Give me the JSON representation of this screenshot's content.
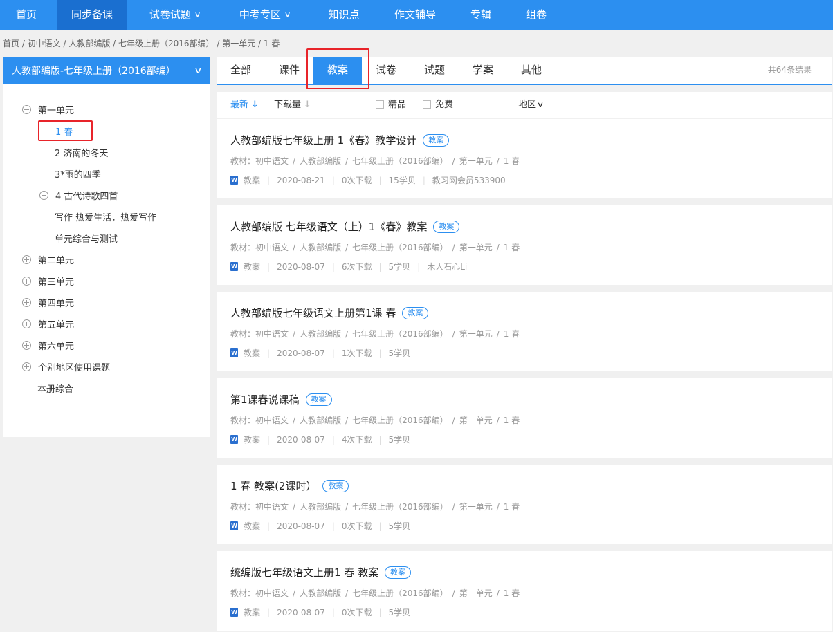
{
  "nav": {
    "items": [
      {
        "label": "首页"
      },
      {
        "label": "同步备课"
      },
      {
        "label": "试卷试题"
      },
      {
        "label": "中考专区"
      },
      {
        "label": "知识点"
      },
      {
        "label": "作文辅导"
      },
      {
        "label": "专辑"
      },
      {
        "label": "组卷"
      }
    ]
  },
  "breadcrumb": {
    "text": "首页 /  初中语文 / 人教部编版 / 七年级上册（2016部编） / 第一单元 / 1 春"
  },
  "sidebar": {
    "header": "人教部编版-七年级上册（2016部编）",
    "tree": [
      {
        "label": "第一单元"
      },
      {
        "label": "1 春"
      },
      {
        "label": "2 济南的冬天"
      },
      {
        "label": "3*雨的四季"
      },
      {
        "label": "4 古代诗歌四首"
      },
      {
        "label": "写作 热爱生活，热爱写作"
      },
      {
        "label": "单元综合与测试"
      },
      {
        "label": "第二单元"
      },
      {
        "label": "第三单元"
      },
      {
        "label": "第四单元"
      },
      {
        "label": "第五单元"
      },
      {
        "label": "第六单元"
      },
      {
        "label": "个别地区使用课题"
      },
      {
        "label": "本册综合"
      }
    ]
  },
  "tabs": {
    "items": [
      {
        "label": "全部"
      },
      {
        "label": "课件"
      },
      {
        "label": "教案"
      },
      {
        "label": "试卷"
      },
      {
        "label": "试题"
      },
      {
        "label": "学案"
      },
      {
        "label": "其他"
      }
    ],
    "result_count": "共64条结果"
  },
  "filters": {
    "latest": "最新",
    "downloads": "下载量",
    "premium": "精品",
    "free": "免费",
    "region": "地区"
  },
  "list": [
    {
      "title": "人教部编版七年级上册 1《春》教学设计",
      "badge": "教案",
      "path": [
        "教材：初中语文",
        "人教部编版",
        "七年级上册（2016部编）",
        "第一单元",
        "1 春"
      ],
      "type": "教案",
      "date": "2020-08-21",
      "downloads": "0次下载",
      "points": "15学贝",
      "author": "教习网会员533900"
    },
    {
      "title": "人教部编版 七年级语文（上）1《春》教案",
      "badge": "教案",
      "path": [
        "教材：初中语文",
        "人教部编版",
        "七年级上册（2016部编）",
        "第一单元",
        "1 春"
      ],
      "type": "教案",
      "date": "2020-08-07",
      "downloads": "6次下载",
      "points": "5学贝",
      "author": "木人石心Li"
    },
    {
      "title": "人教部编版七年级语文上册第1课 春",
      "badge": "教案",
      "path": [
        "教材：初中语文",
        "人教部编版",
        "七年级上册（2016部编）",
        "第一单元",
        "1 春"
      ],
      "type": "教案",
      "date": "2020-08-07",
      "downloads": "1次下载",
      "points": "5学贝",
      "author": ""
    },
    {
      "title": "第1课春说课稿",
      "badge": "教案",
      "path": [
        "教材：初中语文",
        "人教部编版",
        "七年级上册（2016部编）",
        "第一单元",
        "1 春"
      ],
      "type": "教案",
      "date": "2020-08-07",
      "downloads": "4次下载",
      "points": "5学贝",
      "author": ""
    },
    {
      "title": "1 春 教案(2课时）",
      "badge": "教案",
      "path": [
        "教材：初中语文",
        "人教部编版",
        "七年级上册（2016部编）",
        "第一单元",
        "1 春"
      ],
      "type": "教案",
      "date": "2020-08-07",
      "downloads": "0次下载",
      "points": "5学贝",
      "author": ""
    },
    {
      "title": "统编版七年级语文上册1 春 教案",
      "badge": "教案",
      "path": [
        "教材：初中语文",
        "人教部编版",
        "七年级上册（2016部编）",
        "第一单元",
        "1 春"
      ],
      "type": "教案",
      "date": "2020-08-07",
      "downloads": "0次下载",
      "points": "5学贝",
      "author": ""
    }
  ],
  "icons": {
    "doc": "W"
  },
  "colors": {
    "primary": "#2c8ff0",
    "highlight_box": "#e8242a"
  }
}
